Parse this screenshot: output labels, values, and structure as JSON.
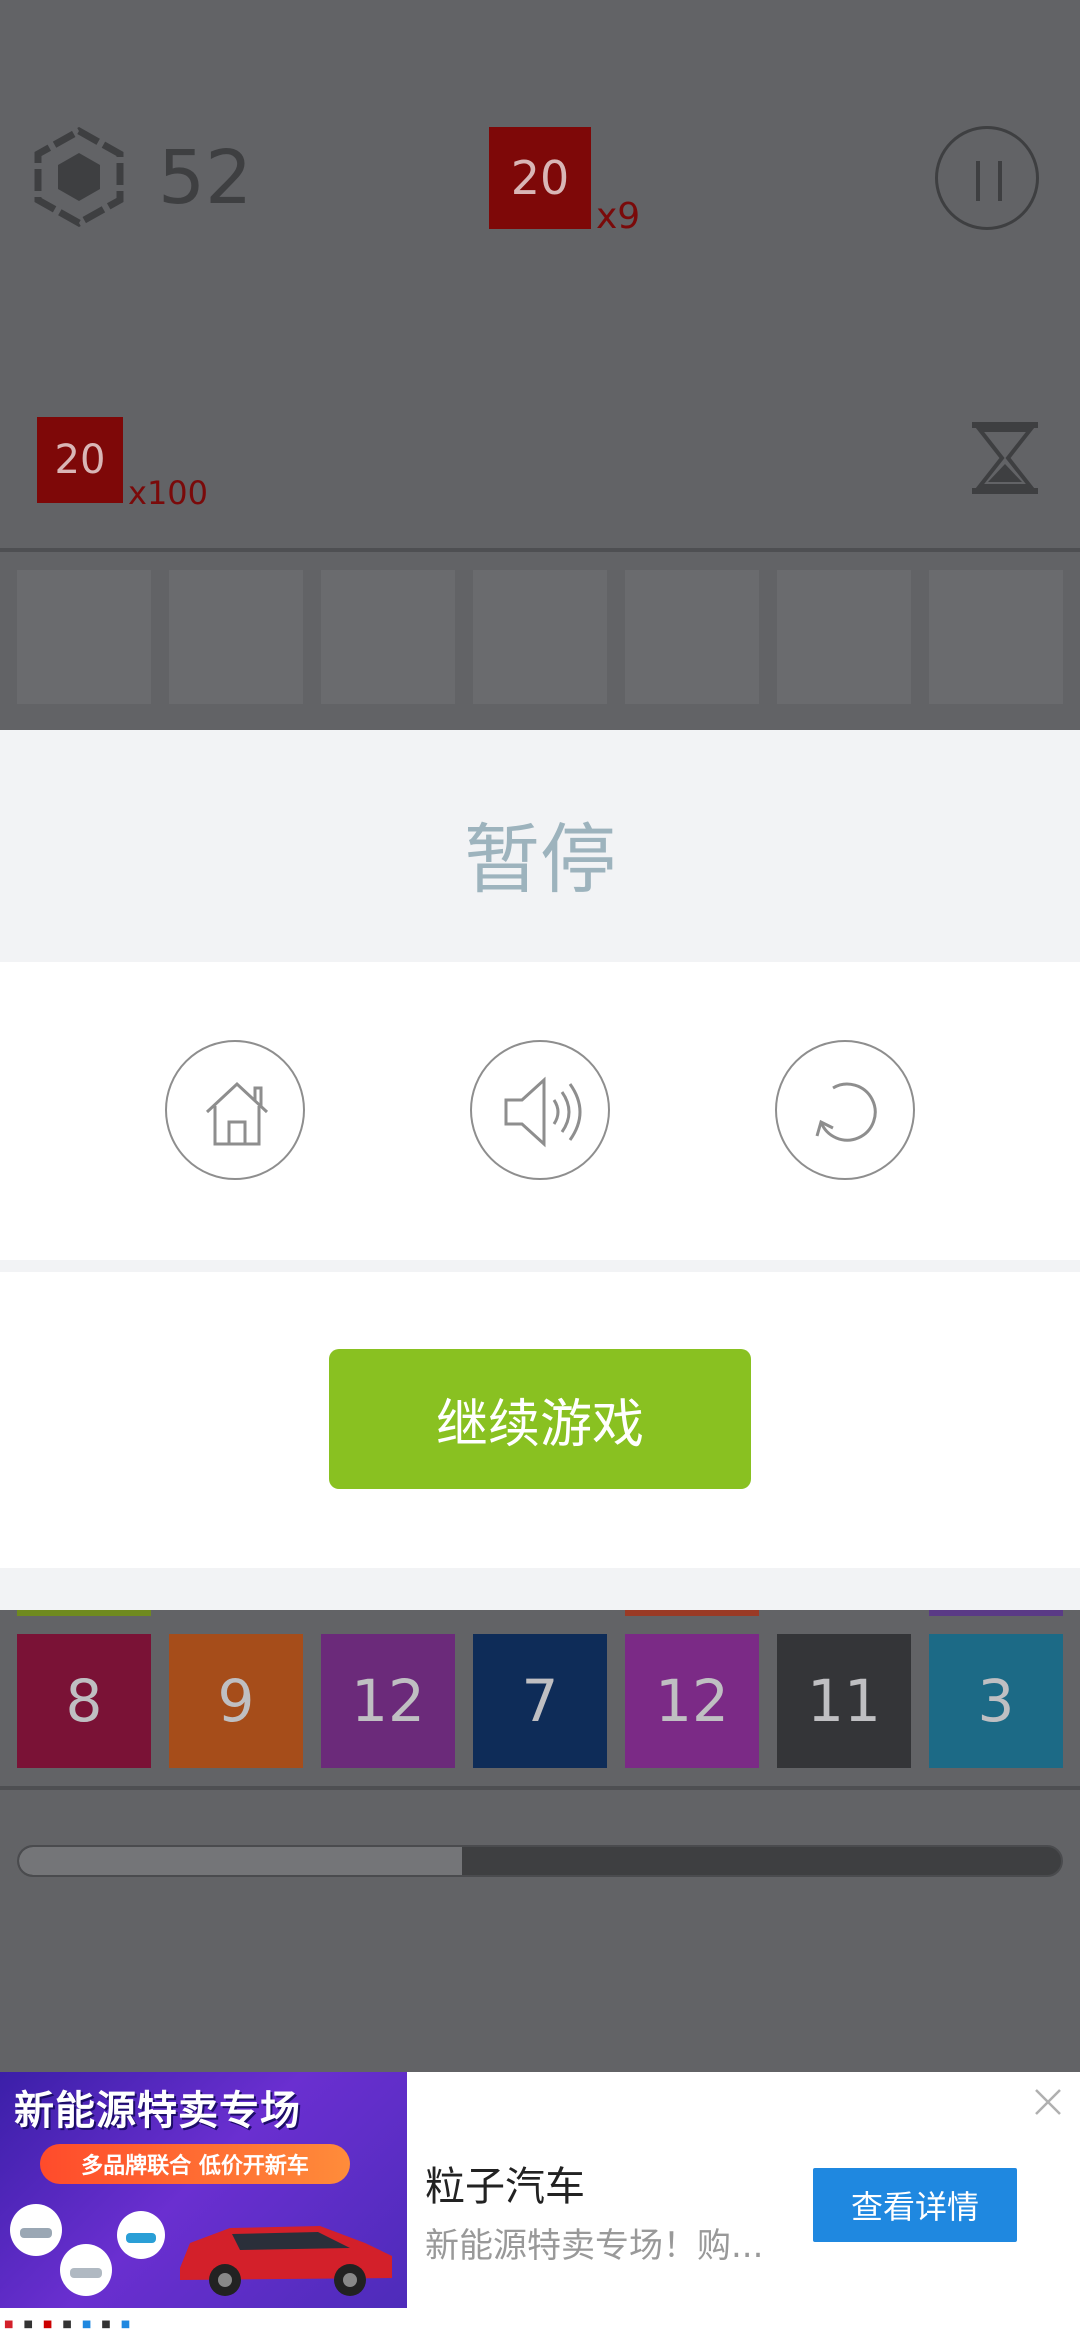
{
  "hud": {
    "score": "52",
    "target_tile": {
      "value": "20",
      "multiplier": "x9"
    },
    "second_tile": {
      "value": "20",
      "multiplier": "x100"
    }
  },
  "dialog": {
    "title": "暂停",
    "buttons": [
      "home-icon",
      "sound-icon",
      "restart-icon"
    ],
    "resume_label": "继续游戏"
  },
  "tiles": [
    {
      "value": "8",
      "color": "#7a1236",
      "marker": "#6f8a1f"
    },
    {
      "value": "9",
      "color": "#a64d1a",
      "marker": ""
    },
    {
      "value": "12",
      "color": "#6b2a7a",
      "marker": ""
    },
    {
      "value": "7",
      "color": "#0e2c58",
      "marker": ""
    },
    {
      "value": "12",
      "color": "#7b2a86",
      "marker": "#9a3a25"
    },
    {
      "value": "11",
      "color": "#343538",
      "marker": ""
    },
    {
      "value": "3",
      "color": "#1c6a86",
      "marker": "#5a3a86"
    }
  ],
  "progress": 0.425,
  "ad": {
    "headline": "新能源特卖专场",
    "pill": "多品牌联合  低价开新车",
    "title": "粒子汽车",
    "description": "新能源特卖专场！购...",
    "cta": "查看详情"
  },
  "colors": {
    "accent_green": "#89c121",
    "cta_blue": "#1f88e0"
  }
}
